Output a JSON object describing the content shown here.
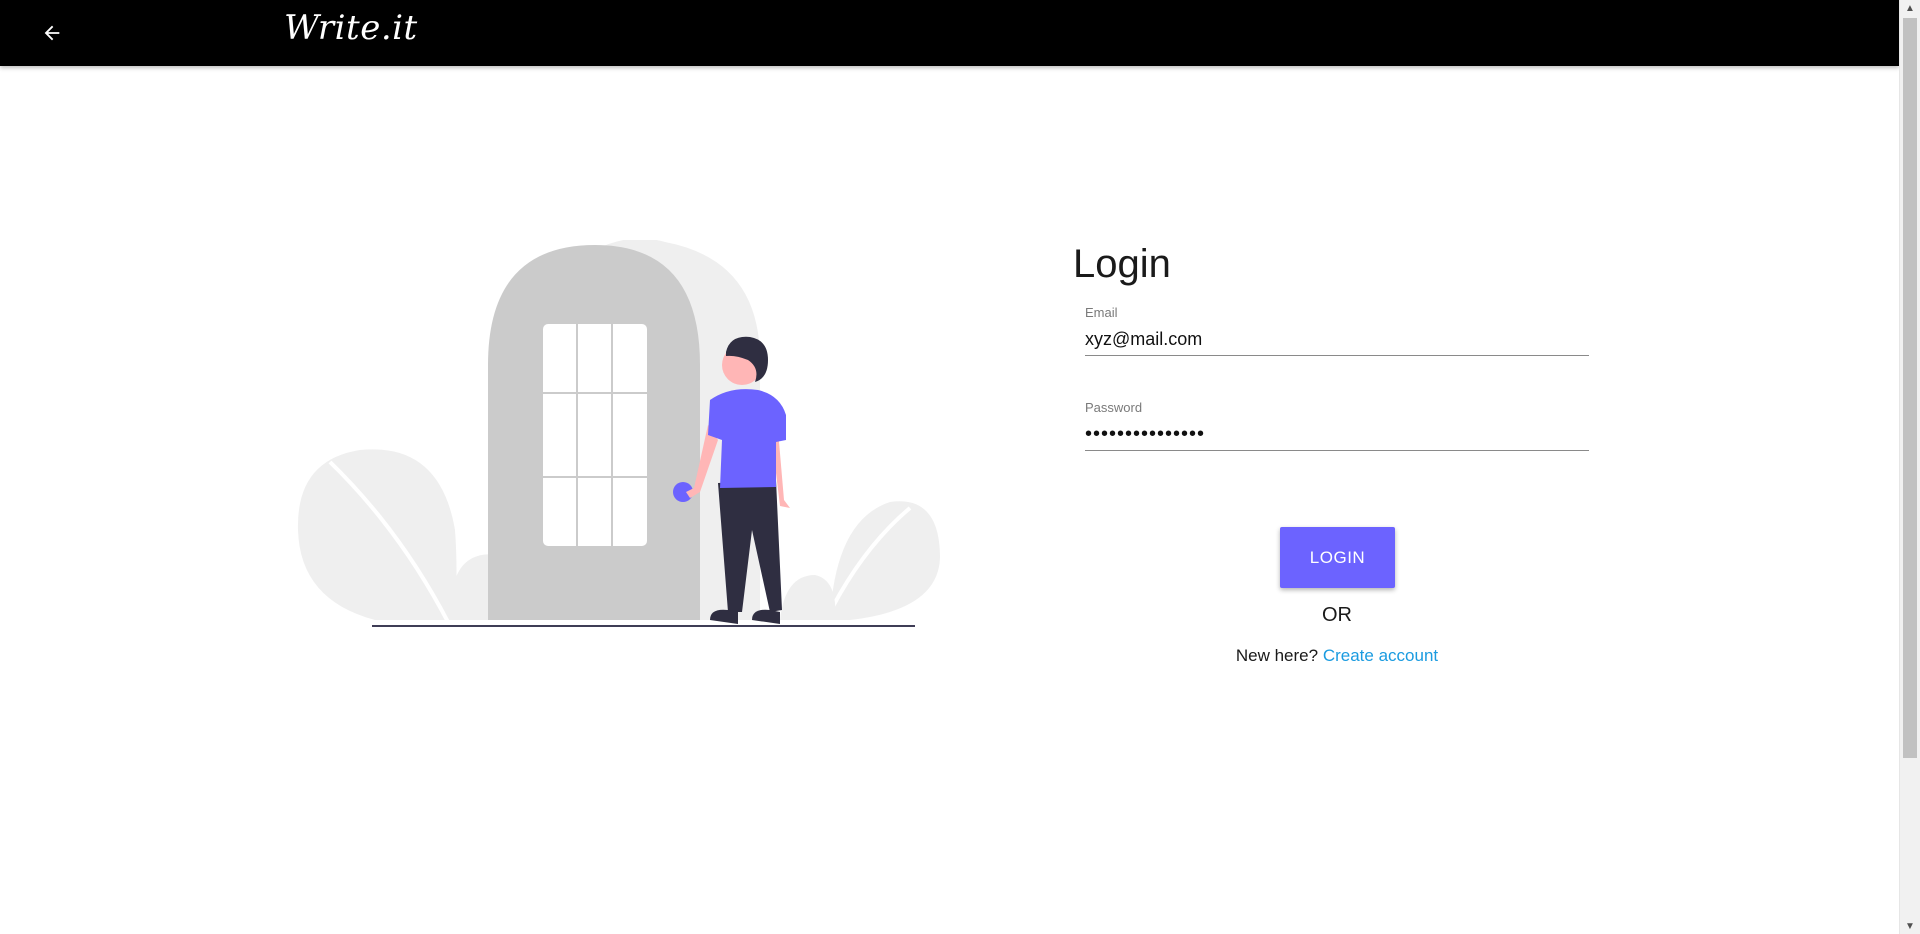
{
  "header": {
    "back_icon": "arrow-left-icon",
    "brand": "Write.it"
  },
  "login": {
    "title": "Login",
    "email": {
      "label": "Email",
      "value": "xyz@mail.com"
    },
    "password": {
      "label": "Password",
      "value": "•••••••••••••••"
    },
    "login_button": "LOGIN",
    "or_text": "OR",
    "signup_prompt": "New here?",
    "signup_link": "Create account"
  },
  "colors": {
    "topbar": "#000000",
    "accent": "#6c63ff",
    "link": "#1a9be0",
    "door": "#cbcbcb",
    "foliage": "#f0f0f0"
  },
  "illustration": {
    "icon": "person-at-door-illustration"
  }
}
